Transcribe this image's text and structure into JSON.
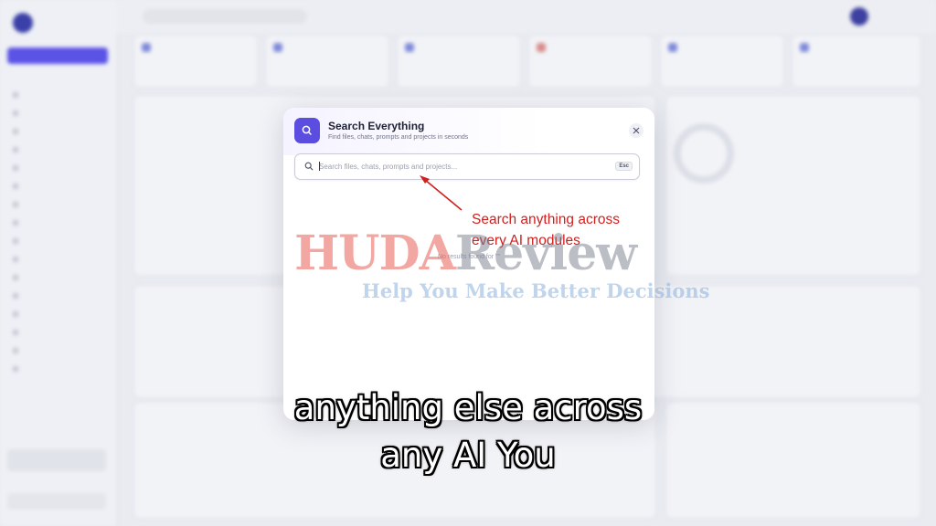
{
  "modal": {
    "title": "Search Everything",
    "subtitle": "Find files, chats, prompts and projects in seconds",
    "search_placeholder": "Search files, chats, prompts and projects...",
    "esc_label": "Esc",
    "close_glyph": "×",
    "empty_state": "No results found for \"\""
  },
  "annotation": {
    "line1": "Search anything across",
    "line2": "every AI modules",
    "color": "#d0201e"
  },
  "watermark": {
    "part1": "HUDA",
    "part2": "Review",
    "tagline": "Help You Make Better Decisions"
  },
  "captions": {
    "line1": "anything else across",
    "line2": "any AI You"
  },
  "colors": {
    "accent": "#5b4de0",
    "caption_text": "#ffffff",
    "caption_outline": "#000000"
  },
  "icons": {
    "modal_icon": "search-icon",
    "close": "close-icon",
    "input_icon": "search-icon"
  }
}
